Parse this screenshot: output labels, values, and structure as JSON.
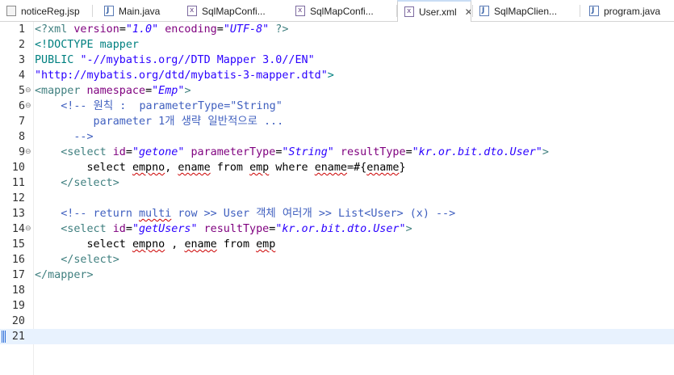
{
  "tabs": [
    {
      "label": "noticeReg.jsp",
      "icon": "jsp-file-icon",
      "active": false
    },
    {
      "label": "Main.java",
      "icon": "java-file-icon",
      "active": false
    },
    {
      "label": "SqlMapConfi...",
      "icon": "xml-file-icon",
      "active": false
    },
    {
      "label": "SqlMapConfi...",
      "icon": "xml-file-icon",
      "active": false
    },
    {
      "label": "User.xml",
      "icon": "xml-file-icon",
      "active": true
    },
    {
      "label": "SqlMapClien...",
      "icon": "java-file-icon",
      "active": false
    },
    {
      "label": "program.java",
      "icon": "java-file-icon",
      "active": false
    }
  ],
  "close_glyph": "✕",
  "editor": {
    "current_line": 21,
    "lines": [
      {
        "n": "1",
        "fold": "",
        "segs": [
          [
            "tg",
            "<?xml "
          ],
          [
            "at",
            "version"
          ],
          [
            "",
            "="
          ],
          [
            "sv",
            "\"1.0\""
          ],
          [
            "",
            ""
          ],
          [
            "at",
            " encoding"
          ],
          [
            "",
            "="
          ],
          [
            "sv",
            "\"UTF-8\""
          ],
          [
            "tg",
            " ?>"
          ]
        ]
      },
      {
        "n": "2",
        "fold": "",
        "segs": [
          [
            "dt",
            "<!DOCTYPE mapper"
          ]
        ]
      },
      {
        "n": "3",
        "fold": "",
        "segs": [
          [
            "dt",
            "PUBLIC "
          ],
          [
            "dq",
            "\"-//mybatis.org//DTD Mapper 3.0//EN\""
          ]
        ]
      },
      {
        "n": "4",
        "fold": "",
        "segs": [
          [
            "dq",
            "\"http://mybatis.org/dtd/mybatis-3-mapper.dtd\""
          ],
          [
            "dt",
            ">"
          ]
        ]
      },
      {
        "n": "5",
        "fold": "⊖",
        "segs": [
          [
            "tg",
            "<mapper "
          ],
          [
            "at",
            "namespace"
          ],
          [
            "",
            "="
          ],
          [
            "sv",
            "\"Emp\""
          ],
          [
            "tg",
            ">"
          ]
        ]
      },
      {
        "n": "6",
        "fold": "⊖",
        "segs": [
          [
            "",
            "    "
          ],
          [
            "cm",
            "<!-- 원칙 :  parameterType=\"String\""
          ]
        ]
      },
      {
        "n": "7",
        "fold": "",
        "segs": [
          [
            "cm",
            "         parameter 1개 생략 일반적으로 ..."
          ]
        ]
      },
      {
        "n": "8",
        "fold": "",
        "segs": [
          [
            "cm",
            "      -->"
          ]
        ]
      },
      {
        "n": "9",
        "fold": "⊖",
        "segs": [
          [
            "",
            "    "
          ],
          [
            "tg",
            "<select "
          ],
          [
            "at",
            "id"
          ],
          [
            "",
            "="
          ],
          [
            "sv",
            "\"getone\""
          ],
          [
            "at",
            " parameterType"
          ],
          [
            "",
            "="
          ],
          [
            "sv",
            "\"String\""
          ],
          [
            "at",
            " resultType"
          ],
          [
            "",
            "="
          ],
          [
            "sv",
            "\"kr.or.bit.dto.User\""
          ],
          [
            "tg",
            ">"
          ]
        ]
      },
      {
        "n": "10",
        "fold": "",
        "segs": [
          [
            "",
            "        select "
          ],
          [
            "sq",
            "empno"
          ],
          [
            "",
            ", "
          ],
          [
            "sq",
            "ename"
          ],
          [
            "",
            " from "
          ],
          [
            "sq",
            "emp"
          ],
          [
            "",
            " where "
          ],
          [
            "sq",
            "ename"
          ],
          [
            "",
            "=#{"
          ],
          [
            "sq",
            "ename"
          ],
          [
            "",
            "}"
          ]
        ]
      },
      {
        "n": "11",
        "fold": "",
        "segs": [
          [
            "",
            "    "
          ],
          [
            "tg",
            "</select>"
          ]
        ]
      },
      {
        "n": "12",
        "fold": "",
        "segs": []
      },
      {
        "n": "13",
        "fold": "",
        "segs": [
          [
            "",
            "    "
          ],
          [
            "cm",
            "<!-- return "
          ],
          [
            "cm sq",
            "multi"
          ],
          [
            "cm",
            " row >> User 객체 여러개 >> List<User> (x) -->"
          ]
        ]
      },
      {
        "n": "14",
        "fold": "⊖",
        "segs": [
          [
            "",
            "    "
          ],
          [
            "tg",
            "<select "
          ],
          [
            "at",
            "id"
          ],
          [
            "",
            "="
          ],
          [
            "sv",
            "\"getUsers\""
          ],
          [
            "at",
            " resultType"
          ],
          [
            "",
            "="
          ],
          [
            "sv",
            "\"kr.or.bit.dto.User\""
          ],
          [
            "tg",
            ">"
          ]
        ]
      },
      {
        "n": "15",
        "fold": "",
        "segs": [
          [
            "",
            "        select "
          ],
          [
            "sq",
            "empno"
          ],
          [
            "",
            " , "
          ],
          [
            "sq",
            "ename"
          ],
          [
            "",
            " from "
          ],
          [
            "sq",
            "emp"
          ]
        ]
      },
      {
        "n": "16",
        "fold": "",
        "segs": [
          [
            "",
            "    "
          ],
          [
            "tg",
            "</select>"
          ]
        ]
      },
      {
        "n": "17",
        "fold": "",
        "segs": [
          [
            "tg",
            "</mapper>"
          ]
        ]
      },
      {
        "n": "18",
        "fold": "",
        "segs": []
      },
      {
        "n": "19",
        "fold": "",
        "segs": []
      },
      {
        "n": "20",
        "fold": "",
        "segs": []
      },
      {
        "n": "21",
        "fold": "",
        "segs": []
      }
    ]
  }
}
